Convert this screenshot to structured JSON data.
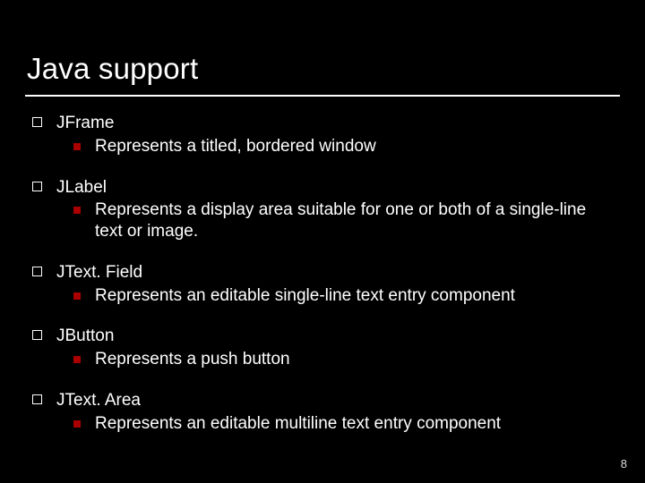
{
  "title": "Java support",
  "items": [
    {
      "name": "JFrame",
      "desc": "Represents a titled, bordered window"
    },
    {
      "name": "JLabel",
      "desc": "Represents a display area suitable for one or both of a single-line text or image."
    },
    {
      "name": "JText. Field",
      "desc": "Represents an editable single-line text entry component"
    },
    {
      "name": "JButton",
      "desc": "Represents a push button"
    },
    {
      "name": "JText. Area",
      "desc": "Represents an editable multiline text entry component"
    }
  ],
  "page_number": "8"
}
